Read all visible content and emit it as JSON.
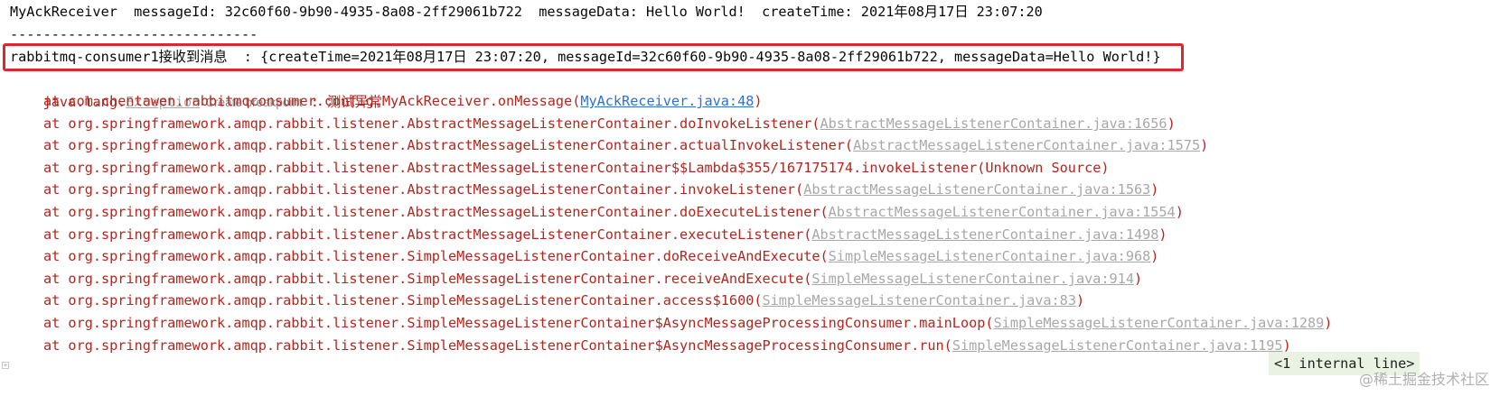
{
  "console": {
    "line1": "MyAckReceiver  messageId: 32c60f60-9b90-4935-8a08-2ff29061b722  messageData: Hello World!  createTime: 2021年08月17日 23:07:20",
    "separator": "------------------------------",
    "received": "rabbitmq-consumer1接收到消息  : {createTime=2021年08月17日 23:07:20, messageId=32c60f60-9b90-4935-8a08-2ff29061b722, messageData=Hello World!}",
    "exception": {
      "prefix": "java.lang.",
      "class": "Exception",
      "breakpoint_label": "Create breakpoint",
      "message": " : 测试异常"
    },
    "stack": [
      {
        "method": "at com.chentawen.rabbitmqconsumer.config.MyAckReceiver.onMessage(",
        "source": "MyAckReceiver.java:48",
        "close": ")"
      },
      {
        "method": "at org.springframework.amqp.rabbit.listener.AbstractMessageListenerContainer.doInvokeListener(",
        "source": "AbstractMessageListenerContainer.java:1656",
        "close": ")"
      },
      {
        "method": "at org.springframework.amqp.rabbit.listener.AbstractMessageListenerContainer.actualInvokeListener(",
        "source": "AbstractMessageListenerContainer.java:1575",
        "close": ")"
      },
      {
        "method": "at org.springframework.amqp.rabbit.listener.AbstractMessageListenerContainer$$Lambda$355/167175174.invokeListener(Unknown Source)",
        "source": "",
        "close": ""
      },
      {
        "method": "at org.springframework.amqp.rabbit.listener.AbstractMessageListenerContainer.invokeListener(",
        "source": "AbstractMessageListenerContainer.java:1563",
        "close": ")"
      },
      {
        "method": "at org.springframework.amqp.rabbit.listener.AbstractMessageListenerContainer.doExecuteListener(",
        "source": "AbstractMessageListenerContainer.java:1554",
        "close": ")"
      },
      {
        "method": "at org.springframework.amqp.rabbit.listener.AbstractMessageListenerContainer.executeListener(",
        "source": "AbstractMessageListenerContainer.java:1498",
        "close": ")"
      },
      {
        "method": "at org.springframework.amqp.rabbit.listener.SimpleMessageListenerContainer.doReceiveAndExecute(",
        "source": "SimpleMessageListenerContainer.java:968",
        "close": ")"
      },
      {
        "method": "at org.springframework.amqp.rabbit.listener.SimpleMessageListenerContainer.receiveAndExecute(",
        "source": "SimpleMessageListenerContainer.java:914",
        "close": ")"
      },
      {
        "method": "at org.springframework.amqp.rabbit.listener.SimpleMessageListenerContainer.access$1600(",
        "source": "SimpleMessageListenerContainer.java:83",
        "close": ")"
      },
      {
        "method": "at org.springframework.amqp.rabbit.listener.SimpleMessageListenerContainer$AsyncMessageProcessingConsumer.mainLoop(",
        "source": "SimpleMessageListenerContainer.java:1289",
        "close": ")"
      },
      {
        "method": "at org.springframework.amqp.rabbit.listener.SimpleMessageListenerContainer$AsyncMessageProcessingConsumer.run(",
        "source": "SimpleMessageListenerContainer.java:1195",
        "close": ")"
      }
    ],
    "internal_lines": "<1 internal line>",
    "watermark": "@稀土掘金技术社区"
  },
  "colors": {
    "highlight_border": "#e0262a",
    "stack_text": "#b3261e",
    "primary_link": "#2f6fd6",
    "dim_link": "#a8a8a8",
    "internal_bg": "#e9f3e4"
  }
}
